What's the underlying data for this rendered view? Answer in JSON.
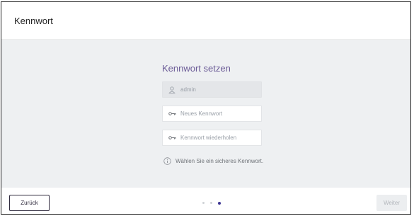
{
  "header": {
    "title": "Kennwort"
  },
  "form": {
    "title": "Kennwort setzen",
    "username": {
      "value": "admin",
      "icon": "user-icon"
    },
    "new_password": {
      "placeholder": "Neues Kennwort",
      "icon": "key-icon"
    },
    "repeat_password": {
      "placeholder": "Kennwort wiederholen",
      "icon": "key-icon"
    },
    "hint": "Wählen Sie ein sicheres Kennwort."
  },
  "footer": {
    "back_label": "Zurück",
    "next_label": "Weiter",
    "steps": {
      "total": 3,
      "current": 3
    }
  },
  "colors": {
    "accent": "#3d3592",
    "title_purple": "#6a5a96",
    "background": "#eef0f2"
  }
}
